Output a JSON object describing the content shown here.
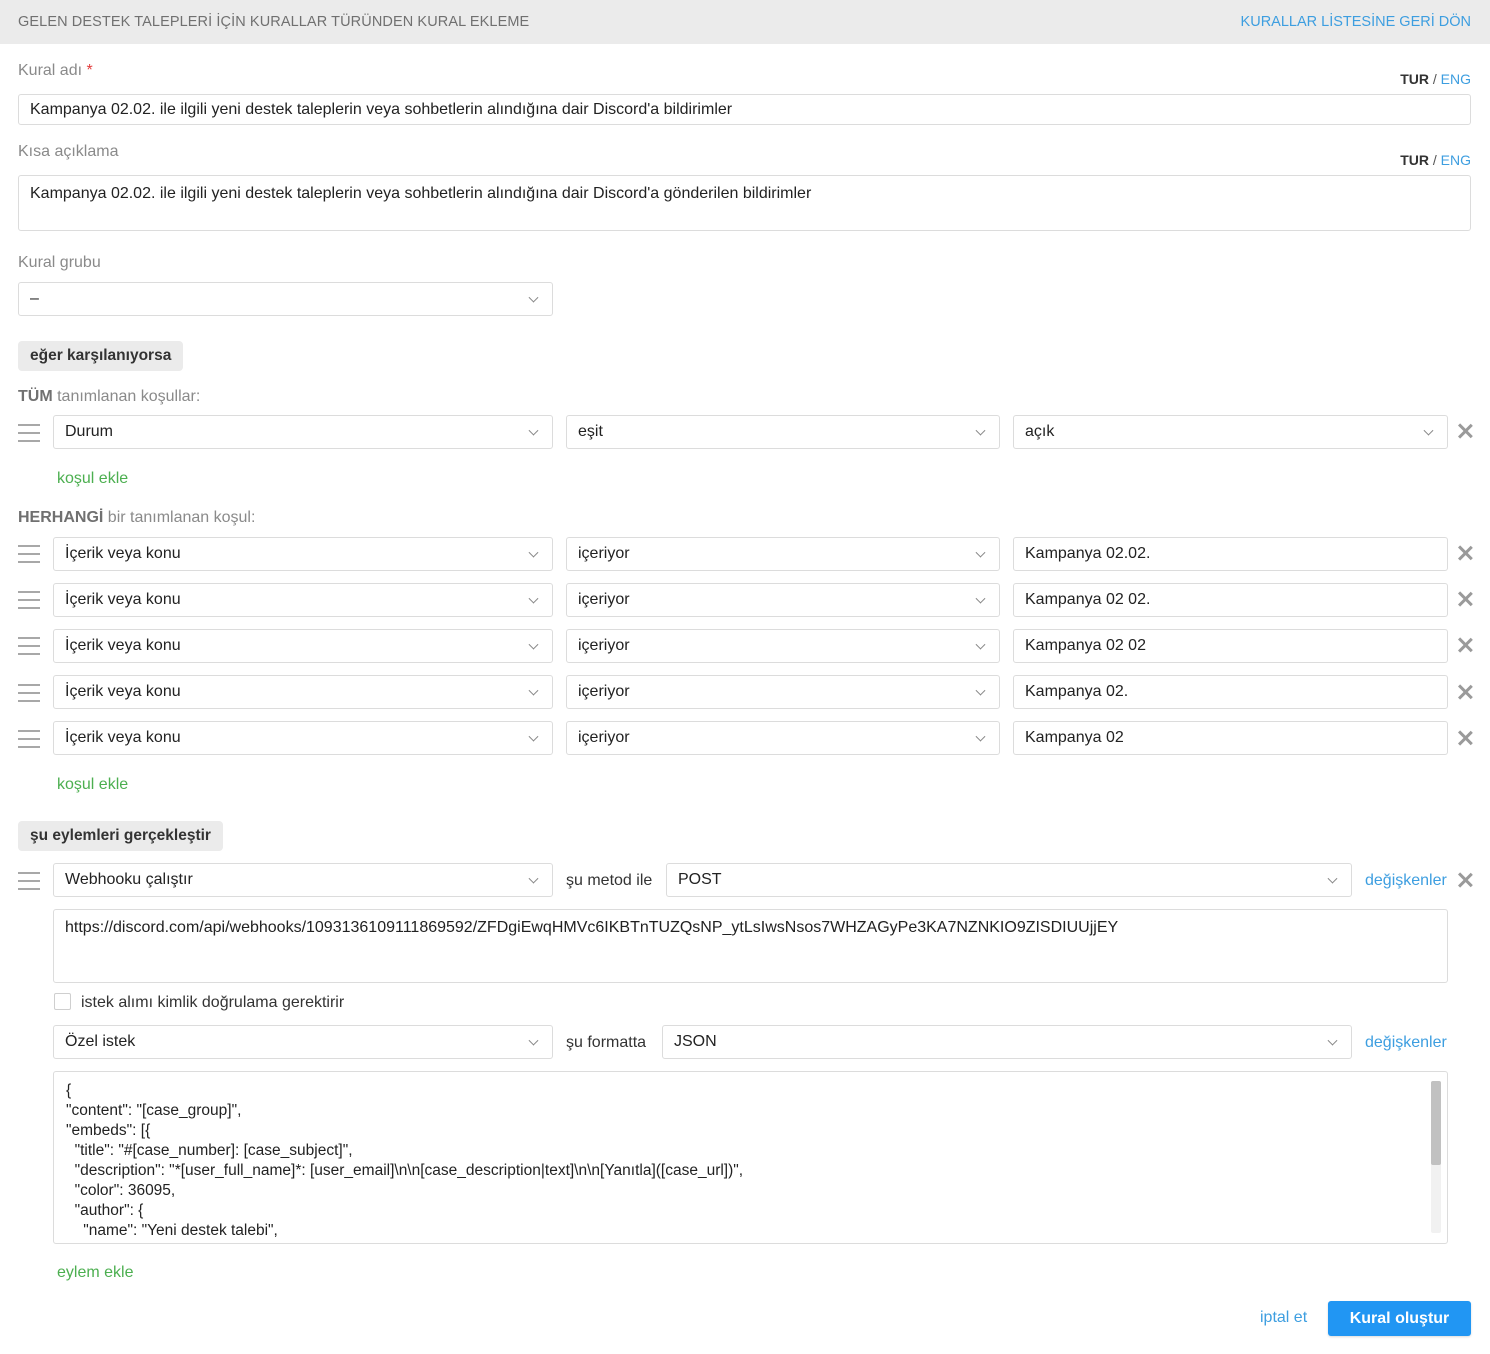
{
  "header": {
    "title": "GELEN DESTEK TALEPLERİ İÇİN KURALLAR TÜRÜNDEN KURAL EKLEME",
    "back_link": "KURALLAR LİSTESİNE GERİ DÖN"
  },
  "lang": {
    "active": "TUR",
    "separator": "/",
    "other": "ENG"
  },
  "rule_name": {
    "label": "Kural adı",
    "required_mark": "*",
    "value": "Kampanya 02.02. ile ilgili yeni destek taleplerin veya sohbetlerin alındığına dair Discord'a bildirimler"
  },
  "short_desc": {
    "label": "Kısa açıklama",
    "value": "Kampanya 02.02. ile ilgili yeni destek taleplerin veya sohbetlerin alındığına dair Discord'a gönderilen bildirimler"
  },
  "rule_group": {
    "label": "Kural grubu",
    "value": "–"
  },
  "if_section": {
    "label": "eğer karşılanıyorsa"
  },
  "all_conditions": {
    "title_bold": "TÜM",
    "title_rest": " tanımlanan koşullar:",
    "rows": [
      {
        "field": "Durum",
        "operator": "eşit",
        "value": "açık"
      }
    ],
    "add_label": "koşul ekle"
  },
  "any_conditions": {
    "title_bold": "HERHANGİ",
    "title_rest": " bir tanımlanan koşul:",
    "rows": [
      {
        "field": "İçerik veya konu",
        "operator": "içeriyor",
        "value": "Kampanya 02.02."
      },
      {
        "field": "İçerik veya konu",
        "operator": "içeriyor",
        "value": "Kampanya 02 02."
      },
      {
        "field": "İçerik veya konu",
        "operator": "içeriyor",
        "value": "Kampanya 02 02"
      },
      {
        "field": "İçerik veya konu",
        "operator": "içeriyor",
        "value": "Kampanya 02."
      },
      {
        "field": "İçerik veya konu",
        "operator": "içeriyor",
        "value": "Kampanya 02"
      }
    ],
    "add_label": "koşul ekle"
  },
  "actions_section": {
    "label": "şu eylemleri gerçekleştir"
  },
  "action": {
    "type": "Webhooku çalıştır",
    "method_label": "şu metod ile",
    "method": "POST",
    "variables_label": "değişkenler",
    "url": "https://discord.com/api/webhooks/1093136109111869592/ZFDgiEwqHMVc6IKBTnTUZQsNP_ytLsIwsNsos7WHZAGyPe3KA7NZNKIO9ZISDIUUjjEY",
    "auth_label": "istek alımı kimlik doğrulama gerektirir",
    "request_type": "Özel istek",
    "format_label": "şu formatta",
    "format": "JSON",
    "format_variables_label": "değişkenler",
    "body_lines": [
      "{",
      "\"content\": \"[case_group]\",",
      "\"embeds\": [{",
      "  \"title\": \"#[case_number]: [case_subject]\",",
      "  \"description\": \"*[user_full_name]*: [user_email]\\n\\n[case_description|text]\\n\\n[Yanıtla]([case_url])\",",
      "  \"color\": 36095,",
      "  \"author\": {",
      "    \"name\": \"Yeni destek talebi\","
    ],
    "add_action_label": "eylem ekle"
  },
  "footer": {
    "cancel_label": "iptal et",
    "submit_label": "Kural oluştur"
  },
  "colors": {
    "accent": "#2196f3",
    "link": "#3d9ee0",
    "add_link": "#4caf50",
    "required": "#e23b3b"
  }
}
